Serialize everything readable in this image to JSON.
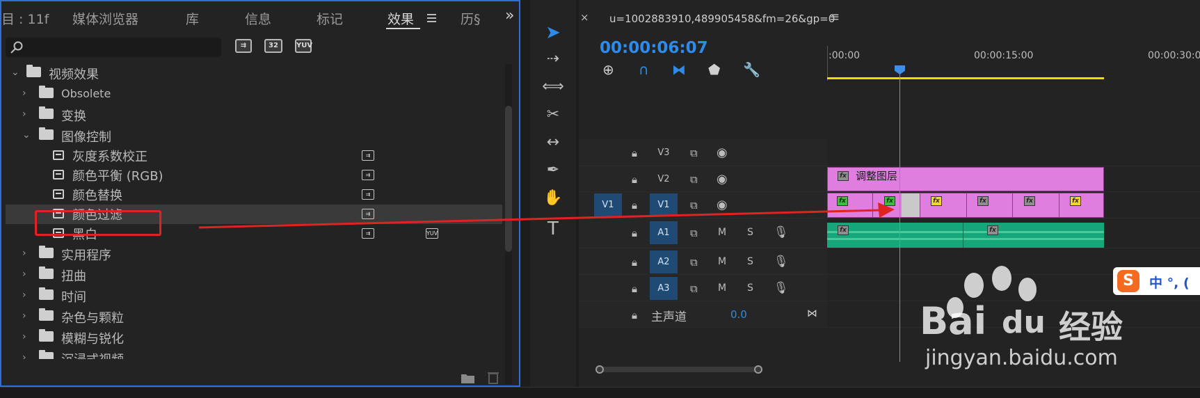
{
  "effects_panel": {
    "tabs": [
      {
        "label": "目 : 11f"
      },
      {
        "label": "媒体浏览器"
      },
      {
        "label": "库"
      },
      {
        "label": "信息"
      },
      {
        "label": "标记"
      },
      {
        "label": "效果"
      },
      {
        "label": "历§"
      }
    ],
    "active_tab": "效果",
    "overflow": "»",
    "search": {
      "value": "",
      "placeholder": ""
    },
    "filter_icons": [
      "加速",
      "32",
      "YUV"
    ],
    "tree": [
      {
        "label": "视频效果",
        "type": "folder",
        "expanded": true
      },
      {
        "label": "Obsolete",
        "type": "folder"
      },
      {
        "label": "变换",
        "type": "folder"
      },
      {
        "label": "图像控制",
        "type": "folder",
        "expanded": true
      },
      {
        "label": "灰度系数校正",
        "type": "effect"
      },
      {
        "label": "颜色平衡 (RGB)",
        "type": "effect"
      },
      {
        "label": "颜色替换",
        "type": "effect"
      },
      {
        "label": "颜色过滤",
        "type": "effect",
        "selected": true
      },
      {
        "label": "黑白",
        "type": "effect",
        "badge2": "YUV"
      },
      {
        "label": "实用程序",
        "type": "folder"
      },
      {
        "label": "扭曲",
        "type": "folder"
      },
      {
        "label": "时间",
        "type": "folder"
      },
      {
        "label": "杂色与颗粒",
        "type": "folder"
      },
      {
        "label": "模糊与锐化",
        "type": "folder"
      },
      {
        "label": "沉浸式视频",
        "type": "folder"
      }
    ]
  },
  "timeline": {
    "sequence_name": "u=1002883910,489905458&fm=26&gp=0",
    "close": "×",
    "menu": "≡",
    "timecode": "00:00:06:07",
    "ruler": [
      ":00:00",
      "00:00:15:00",
      "00:00:30:0"
    ],
    "tracks": [
      {
        "name": "V3",
        "kind": "video"
      },
      {
        "name": "V2",
        "kind": "video"
      },
      {
        "name": "V1",
        "kind": "video",
        "source": "V1"
      },
      {
        "name": "A1",
        "kind": "audio"
      },
      {
        "name": "A2",
        "kind": "audio"
      },
      {
        "name": "A3",
        "kind": "audio"
      }
    ],
    "audio_buttons": {
      "mute": "M",
      "solo": "S"
    },
    "master": {
      "label": "主声道",
      "value": "0.0"
    },
    "adjustment_clip_label": "调整图层",
    "fx": "fx"
  },
  "watermark": {
    "brand": "Bai",
    "du": "du",
    "jingyan": "经验",
    "url": "jingyan.baidu.com"
  },
  "ime": {
    "logo": "S",
    "text": "中 °, ("
  },
  "colors": {
    "accent": "#2d8ceb",
    "clip_video": "#e07ee0",
    "clip_audio": "#15a679",
    "work_area": "#e8e100",
    "annotation": "#e02222"
  }
}
